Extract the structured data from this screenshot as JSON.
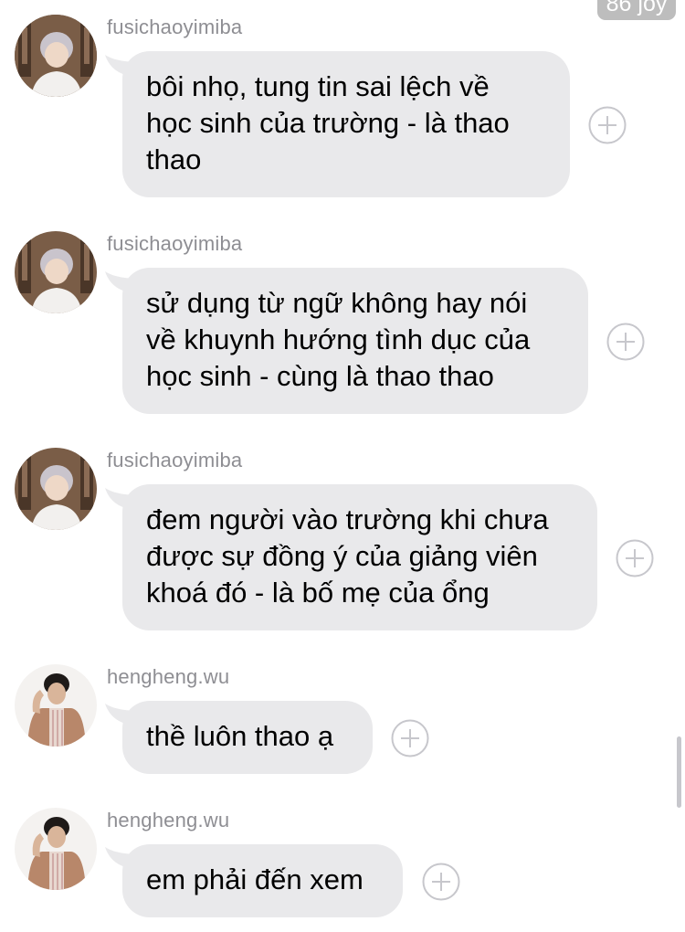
{
  "header": {
    "badge_text": "86 joy"
  },
  "messages": [
    {
      "sender": "fusichaoyimiba",
      "avatar": "avatar-fusichaoyimiba",
      "text": "bôi nhọ, tung tin sai lệch về\nhọc sinh của trường - là thao\nthao",
      "action_icon": "plus-circle-icon"
    },
    {
      "sender": "fusichaoyimiba",
      "avatar": "avatar-fusichaoyimiba",
      "text": "sử dụng từ ngữ không hay nói\nvề khuynh hướng tình dục của\nhọc sinh - cùng là thao thao",
      "action_icon": "plus-circle-icon"
    },
    {
      "sender": "fusichaoyimiba",
      "avatar": "avatar-fusichaoyimiba",
      "text": "đem người vào trường khi chưa\nđược sự đồng ý của giảng viên\nkhoá đó - là bố mẹ của ổng",
      "action_icon": "plus-circle-icon"
    },
    {
      "sender": "hengheng.wu",
      "avatar": "avatar-hengheng-wu",
      "text": "thề luôn thao ạ",
      "action_icon": "plus-circle-icon"
    },
    {
      "sender": "hengheng.wu",
      "avatar": "avatar-hengheng-wu",
      "text": "em phải đến xem",
      "action_icon": "plus-circle-icon"
    }
  ],
  "colors": {
    "bubble": "#e9e9eb",
    "sender_text": "#8e8e93",
    "plus_icon": "#c7c7cc"
  }
}
